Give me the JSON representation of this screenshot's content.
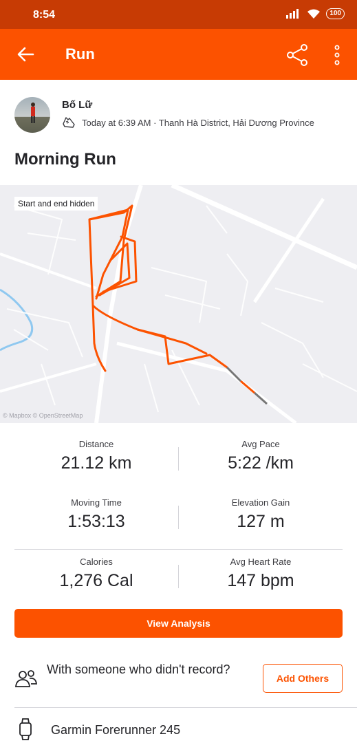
{
  "status_bar": {
    "time": "8:54",
    "battery": "100"
  },
  "app_bar": {
    "title": "Run"
  },
  "athlete": {
    "name": "Bố Lữ",
    "meta": "Today at 6:39 AM · Thanh Hà District, Hải Dương Province"
  },
  "activity": {
    "title": "Morning Run"
  },
  "map": {
    "note": "Start and end hidden",
    "attribution": "© Mapbox © OpenStreetMap",
    "route_color": "#fc5200"
  },
  "stats": [
    {
      "label": "Distance",
      "value": "21.12 km"
    },
    {
      "label": "Avg Pace",
      "value": "5:22 /km"
    },
    {
      "label": "Moving Time",
      "value": "1:53:13"
    },
    {
      "label": "Elevation Gain",
      "value": "127 m"
    },
    {
      "label": "Calories",
      "value": "1,276 Cal"
    },
    {
      "label": "Avg Heart Rate",
      "value": "147 bpm"
    }
  ],
  "actions": {
    "view_analysis": "View Analysis",
    "together_text": "With someone who didn't record?",
    "add_others": "Add Others"
  },
  "device": {
    "name": "Garmin Forerunner 245"
  },
  "colors": {
    "accent": "#fc5200",
    "status_bar": "#c73b04"
  }
}
